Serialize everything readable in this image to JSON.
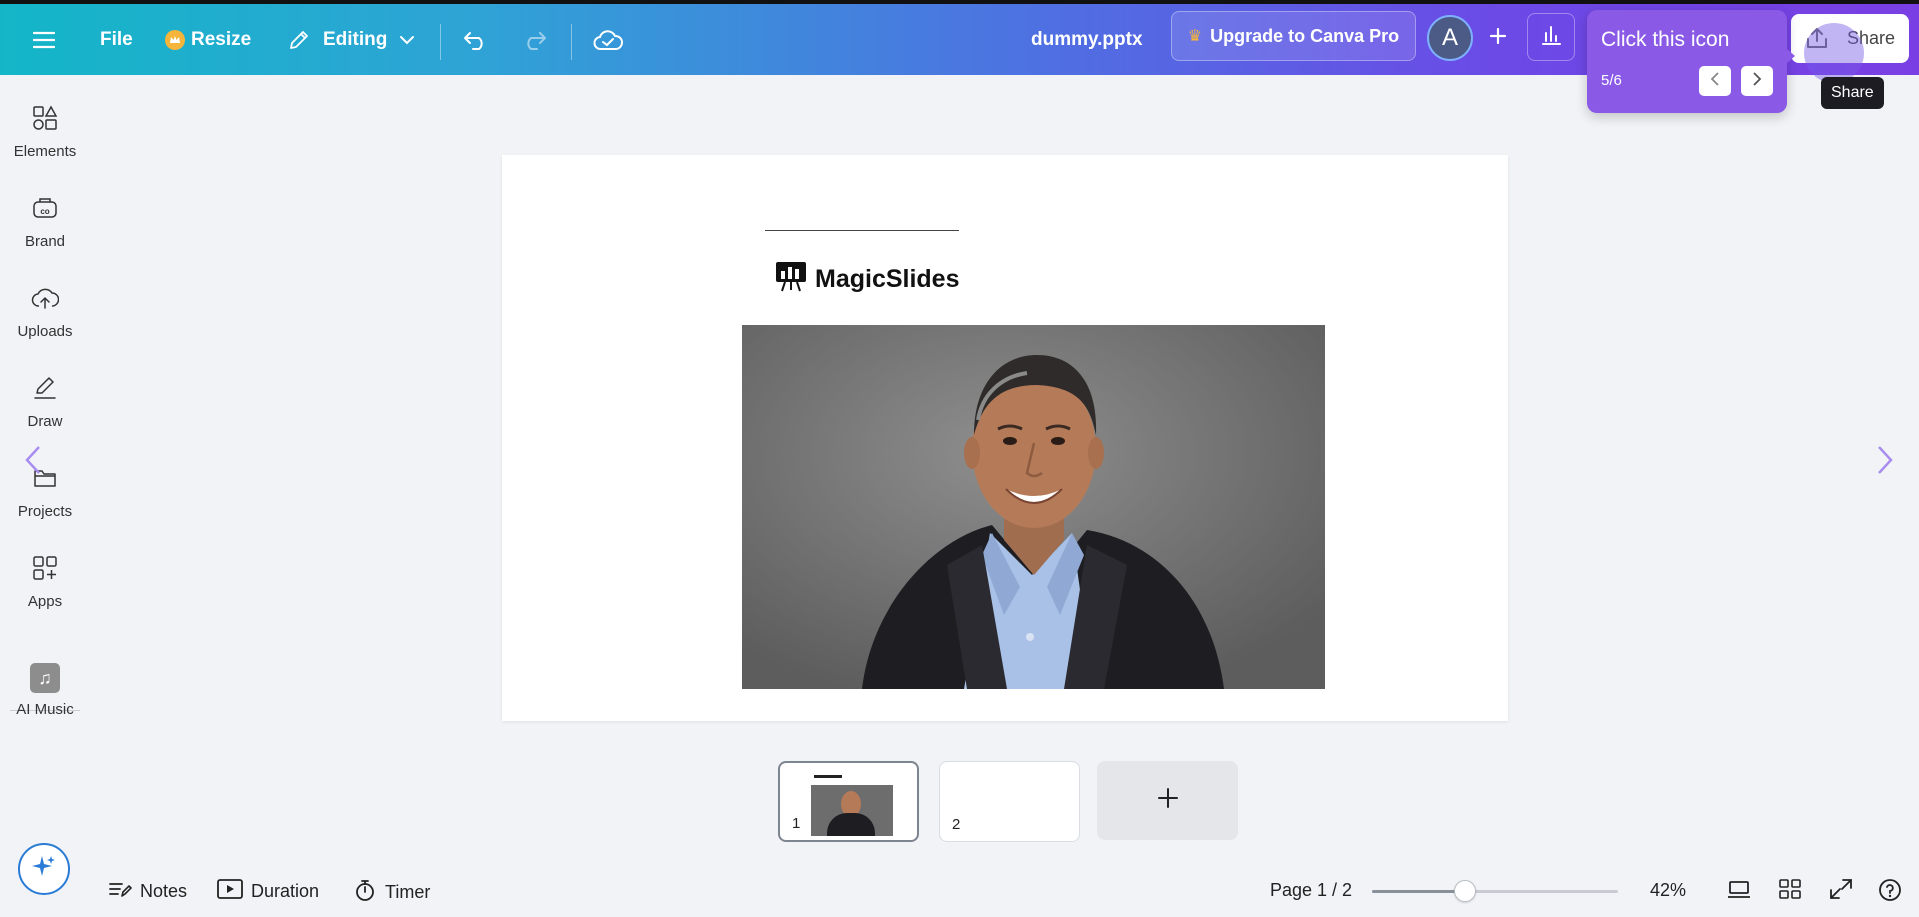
{
  "topbar": {
    "file_label": "File",
    "resize_label": "Resize",
    "editing_label": "Editing",
    "doc_title": "dummy.pptx",
    "upgrade_label": "Upgrade to Canva Pro",
    "avatar_initial": "A",
    "share_label": "Share",
    "share_tooltip": "Share"
  },
  "guide": {
    "title": "Click this icon",
    "step": "5/6"
  },
  "sidebar": {
    "items": [
      {
        "label": "Elements",
        "icon": "elements-icon"
      },
      {
        "label": "Brand",
        "icon": "brand-icon"
      },
      {
        "label": "Uploads",
        "icon": "cloud-upload-icon"
      },
      {
        "label": "Draw",
        "icon": "pen-icon"
      },
      {
        "label": "Projects",
        "icon": "folder-icon"
      },
      {
        "label": "Apps",
        "icon": "apps-grid-icon"
      },
      {
        "label": "AI Music",
        "icon": "music-note-icon"
      }
    ]
  },
  "slide": {
    "logo_text": "MagicSlides"
  },
  "thumbnails": [
    {
      "number": "1",
      "active": true
    },
    {
      "number": "2",
      "active": false
    }
  ],
  "bottombar": {
    "notes_label": "Notes",
    "duration_label": "Duration",
    "timer_label": "Timer",
    "page_indicator": "Page 1 / 2",
    "zoom_level": "42%",
    "zoom_fraction": 0.38
  },
  "colors": {
    "accent_purple": "#8a5ae6",
    "gradient_start": "#13b6c7",
    "gradient_end": "#7a3fe4"
  }
}
